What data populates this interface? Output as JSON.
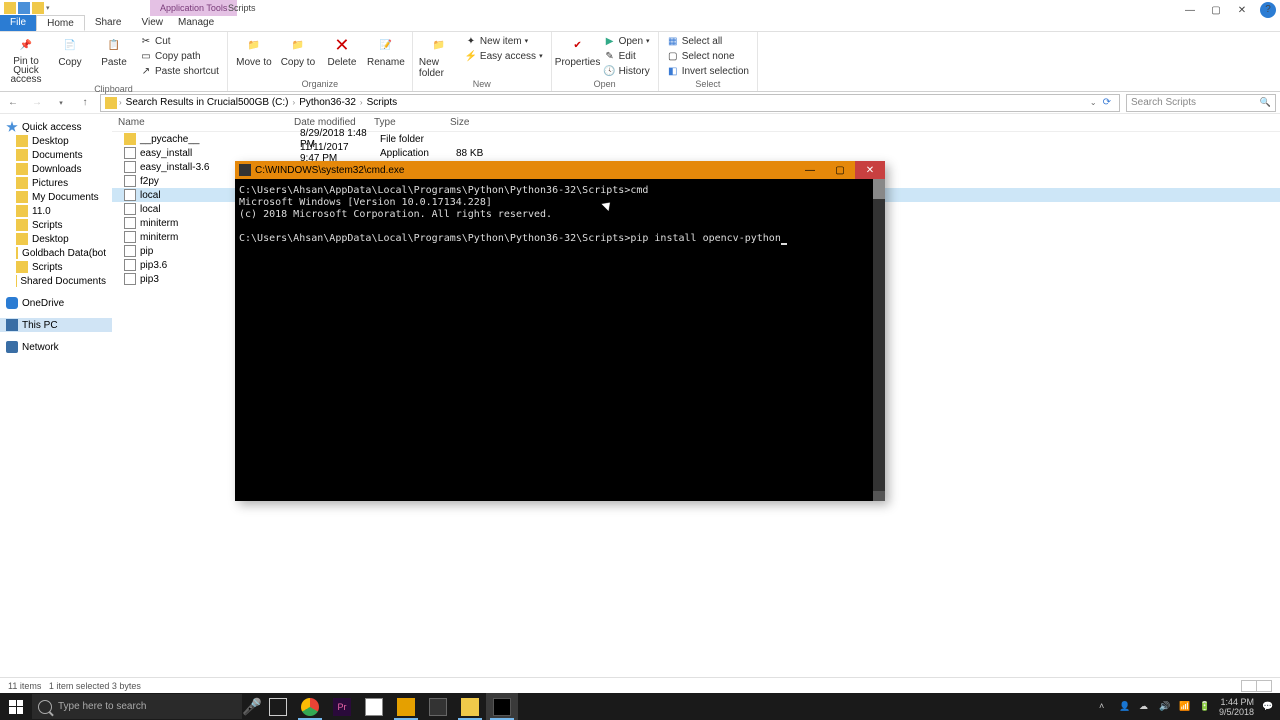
{
  "qat": {
    "tooltab": "Application Tools",
    "title": "Scripts"
  },
  "tabs": {
    "file": "File",
    "home": "Home",
    "share": "Share",
    "view": "View",
    "manage": "Manage"
  },
  "ribbon": {
    "clipboard": {
      "label": "Clipboard",
      "pin": "Pin to Quick access",
      "copy": "Copy",
      "paste": "Paste",
      "cut": "Cut",
      "copypath": "Copy path",
      "pasteshort": "Paste shortcut"
    },
    "organize": {
      "label": "Organize",
      "moveto": "Move to",
      "copyto": "Copy to",
      "delete": "Delete",
      "rename": "Rename"
    },
    "new": {
      "label": "New",
      "newfolder": "New folder",
      "newitem": "New item",
      "easyaccess": "Easy access"
    },
    "open": {
      "label": "Open",
      "properties": "Properties",
      "open": "Open",
      "edit": "Edit",
      "history": "History"
    },
    "select": {
      "label": "Select",
      "all": "Select all",
      "none": "Select none",
      "invert": "Invert selection"
    }
  },
  "breadcrumb": {
    "root": "Search Results in Crucial500GB (C:)",
    "l1": "Python36-32",
    "l2": "Scripts"
  },
  "search": {
    "placeholder": "Search Scripts"
  },
  "columns": {
    "name": "Name",
    "date": "Date modified",
    "type": "Type",
    "size": "Size"
  },
  "nav": {
    "quick": "Quick access",
    "items": [
      "Desktop",
      "Documents",
      "Downloads",
      "Pictures",
      "My Documents",
      "11.0",
      "Scripts",
      "Desktop",
      "Goldbach Data(bot",
      "Scripts",
      "Shared Documents"
    ],
    "onedrive": "OneDrive",
    "thispc": "This PC",
    "network": "Network"
  },
  "files": [
    {
      "name": "__pycache__",
      "date": "8/29/2018 1:48 PM",
      "type": "File folder",
      "size": ""
    },
    {
      "name": "easy_install",
      "date": "11/11/2017 9:47 PM",
      "type": "Application",
      "size": "88 KB"
    },
    {
      "name": "easy_install-3.6",
      "date": "",
      "type": "",
      "size": ""
    },
    {
      "name": "f2py",
      "date": "",
      "type": "",
      "size": ""
    },
    {
      "name": "local",
      "date": "",
      "type": "",
      "size": ""
    },
    {
      "name": "local",
      "date": "",
      "type": "",
      "size": ""
    },
    {
      "name": "miniterm",
      "date": "",
      "type": "",
      "size": ""
    },
    {
      "name": "miniterm",
      "date": "",
      "type": "",
      "size": ""
    },
    {
      "name": "pip",
      "date": "",
      "type": "",
      "size": ""
    },
    {
      "name": "pip3.6",
      "date": "",
      "type": "",
      "size": ""
    },
    {
      "name": "pip3",
      "date": "",
      "type": "",
      "size": ""
    }
  ],
  "status": {
    "count": "11 items",
    "sel": "1 item selected  3 bytes"
  },
  "cmd": {
    "title": "C:\\WINDOWS\\system32\\cmd.exe",
    "lines": [
      "C:\\Users\\Ahsan\\AppData\\Local\\Programs\\Python\\Python36-32\\Scripts>cmd",
      "Microsoft Windows [Version 10.0.17134.228]",
      "(c) 2018 Microsoft Corporation. All rights reserved.",
      "",
      "C:\\Users\\Ahsan\\AppData\\Local\\Programs\\Python\\Python36-32\\Scripts>pip install opencv-python"
    ]
  },
  "taskbar": {
    "search": "Type here to search",
    "time": "1:44 PM",
    "date": "9/5/2018"
  }
}
